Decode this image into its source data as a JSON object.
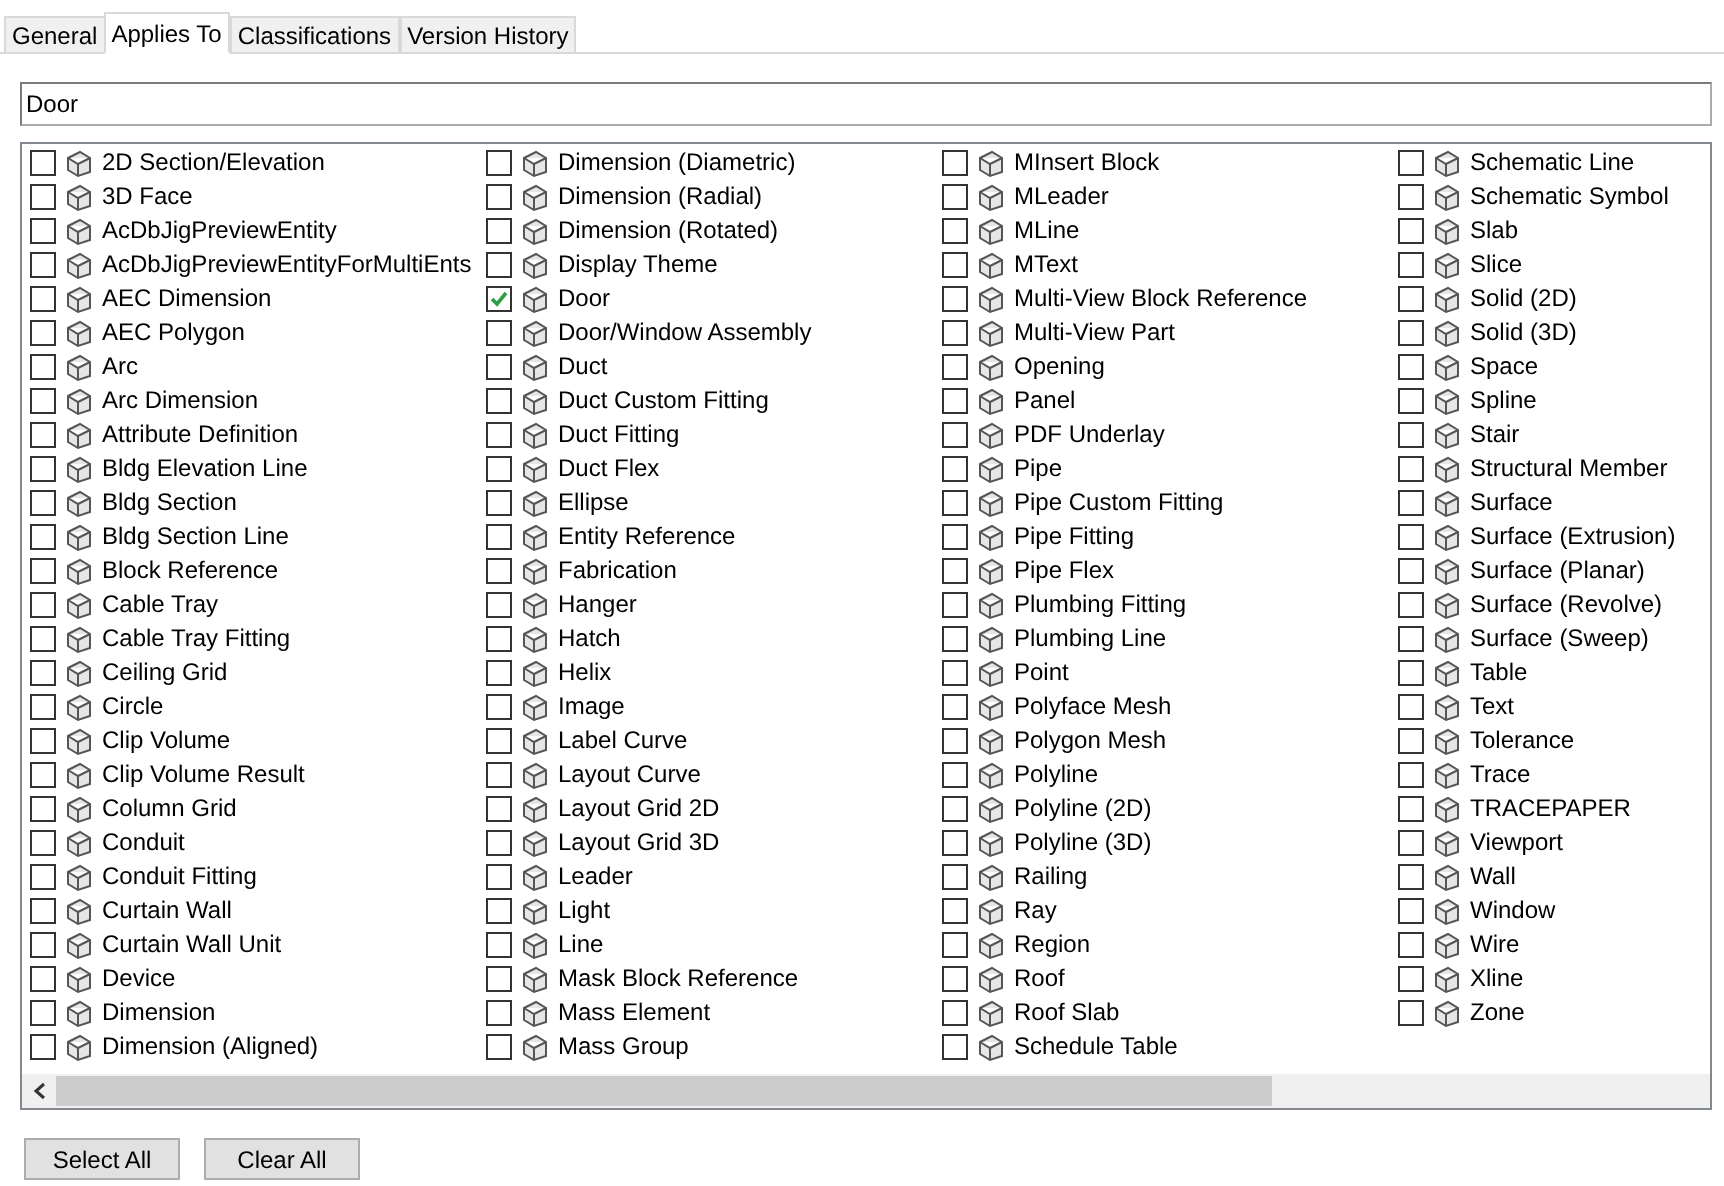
{
  "tabs": [
    {
      "label": "General",
      "selected": false
    },
    {
      "label": "Applies To",
      "selected": true
    },
    {
      "label": "Classifications",
      "selected": false
    },
    {
      "label": "Version History",
      "selected": false
    }
  ],
  "filter": {
    "value": "Door"
  },
  "items": [
    {
      "label": "2D Section/Elevation",
      "checked": false
    },
    {
      "label": "3D Face",
      "checked": false
    },
    {
      "label": "AcDbJigPreviewEntity",
      "checked": false
    },
    {
      "label": "AcDbJigPreviewEntityForMultiEnts",
      "checked": false
    },
    {
      "label": "AEC Dimension",
      "checked": false
    },
    {
      "label": "AEC Polygon",
      "checked": false
    },
    {
      "label": "Arc",
      "checked": false
    },
    {
      "label": "Arc Dimension",
      "checked": false
    },
    {
      "label": "Attribute Definition",
      "checked": false
    },
    {
      "label": "Bldg Elevation Line",
      "checked": false
    },
    {
      "label": "Bldg Section",
      "checked": false
    },
    {
      "label": "Bldg Section Line",
      "checked": false
    },
    {
      "label": "Block Reference",
      "checked": false
    },
    {
      "label": "Cable Tray",
      "checked": false
    },
    {
      "label": "Cable Tray Fitting",
      "checked": false
    },
    {
      "label": "Ceiling Grid",
      "checked": false
    },
    {
      "label": "Circle",
      "checked": false
    },
    {
      "label": "Clip Volume",
      "checked": false
    },
    {
      "label": "Clip Volume Result",
      "checked": false
    },
    {
      "label": "Column Grid",
      "checked": false
    },
    {
      "label": "Conduit",
      "checked": false
    },
    {
      "label": "Conduit Fitting",
      "checked": false
    },
    {
      "label": "Curtain Wall",
      "checked": false
    },
    {
      "label": "Curtain Wall Unit",
      "checked": false
    },
    {
      "label": "Device",
      "checked": false
    },
    {
      "label": "Dimension",
      "checked": false
    },
    {
      "label": "Dimension (Aligned)",
      "checked": false
    },
    {
      "label": "Dimension (Diametric)",
      "checked": false
    },
    {
      "label": "Dimension (Radial)",
      "checked": false
    },
    {
      "label": "Dimension (Rotated)",
      "checked": false
    },
    {
      "label": "Display Theme",
      "checked": false
    },
    {
      "label": "Door",
      "checked": true
    },
    {
      "label": "Door/Window Assembly",
      "checked": false
    },
    {
      "label": "Duct",
      "checked": false
    },
    {
      "label": "Duct Custom Fitting",
      "checked": false
    },
    {
      "label": "Duct Fitting",
      "checked": false
    },
    {
      "label": "Duct Flex",
      "checked": false
    },
    {
      "label": "Ellipse",
      "checked": false
    },
    {
      "label": "Entity Reference",
      "checked": false
    },
    {
      "label": "Fabrication",
      "checked": false
    },
    {
      "label": "Hanger",
      "checked": false
    },
    {
      "label": "Hatch",
      "checked": false
    },
    {
      "label": "Helix",
      "checked": false
    },
    {
      "label": "Image",
      "checked": false
    },
    {
      "label": "Label Curve",
      "checked": false
    },
    {
      "label": "Layout Curve",
      "checked": false
    },
    {
      "label": "Layout Grid 2D",
      "checked": false
    },
    {
      "label": "Layout Grid 3D",
      "checked": false
    },
    {
      "label": "Leader",
      "checked": false
    },
    {
      "label": "Light",
      "checked": false
    },
    {
      "label": "Line",
      "checked": false
    },
    {
      "label": "Mask Block Reference",
      "checked": false
    },
    {
      "label": "Mass Element",
      "checked": false
    },
    {
      "label": "Mass Group",
      "checked": false
    },
    {
      "label": "MInsert Block",
      "checked": false
    },
    {
      "label": "MLeader",
      "checked": false
    },
    {
      "label": "MLine",
      "checked": false
    },
    {
      "label": "MText",
      "checked": false
    },
    {
      "label": "Multi-View Block Reference",
      "checked": false
    },
    {
      "label": "Multi-View Part",
      "checked": false
    },
    {
      "label": "Opening",
      "checked": false
    },
    {
      "label": "Panel",
      "checked": false
    },
    {
      "label": "PDF Underlay",
      "checked": false
    },
    {
      "label": "Pipe",
      "checked": false
    },
    {
      "label": "Pipe Custom Fitting",
      "checked": false
    },
    {
      "label": "Pipe Fitting",
      "checked": false
    },
    {
      "label": "Pipe Flex",
      "checked": false
    },
    {
      "label": "Plumbing Fitting",
      "checked": false
    },
    {
      "label": "Plumbing Line",
      "checked": false
    },
    {
      "label": "Point",
      "checked": false
    },
    {
      "label": "Polyface Mesh",
      "checked": false
    },
    {
      "label": "Polygon Mesh",
      "checked": false
    },
    {
      "label": "Polyline",
      "checked": false
    },
    {
      "label": "Polyline (2D)",
      "checked": false
    },
    {
      "label": "Polyline (3D)",
      "checked": false
    },
    {
      "label": "Railing",
      "checked": false
    },
    {
      "label": "Ray",
      "checked": false
    },
    {
      "label": "Region",
      "checked": false
    },
    {
      "label": "Roof",
      "checked": false
    },
    {
      "label": "Roof Slab",
      "checked": false
    },
    {
      "label": "Schedule Table",
      "checked": false
    },
    {
      "label": "Schematic Line",
      "checked": false
    },
    {
      "label": "Schematic Symbol",
      "checked": false
    },
    {
      "label": "Slab",
      "checked": false
    },
    {
      "label": "Slice",
      "checked": false
    },
    {
      "label": "Solid (2D)",
      "checked": false
    },
    {
      "label": "Solid (3D)",
      "checked": false
    },
    {
      "label": "Space",
      "checked": false
    },
    {
      "label": "Spline",
      "checked": false
    },
    {
      "label": "Stair",
      "checked": false
    },
    {
      "label": "Structural Member",
      "checked": false
    },
    {
      "label": "Surface",
      "checked": false
    },
    {
      "label": "Surface (Extrusion)",
      "checked": false
    },
    {
      "label": "Surface (Planar)",
      "checked": false
    },
    {
      "label": "Surface (Revolve)",
      "checked": false
    },
    {
      "label": "Surface (Sweep)",
      "checked": false
    },
    {
      "label": "Table",
      "checked": false
    },
    {
      "label": "Text",
      "checked": false
    },
    {
      "label": "Tolerance",
      "checked": false
    },
    {
      "label": "Trace",
      "checked": false
    },
    {
      "label": "TRACEPAPER",
      "checked": false
    },
    {
      "label": "Viewport",
      "checked": false
    },
    {
      "label": "Wall",
      "checked": false
    },
    {
      "label": "Window",
      "checked": false
    },
    {
      "label": "Wire",
      "checked": false
    },
    {
      "label": "Xline",
      "checked": false
    },
    {
      "label": "Zone",
      "checked": false
    }
  ],
  "buttons": [
    "Select All",
    "Clear All"
  ]
}
